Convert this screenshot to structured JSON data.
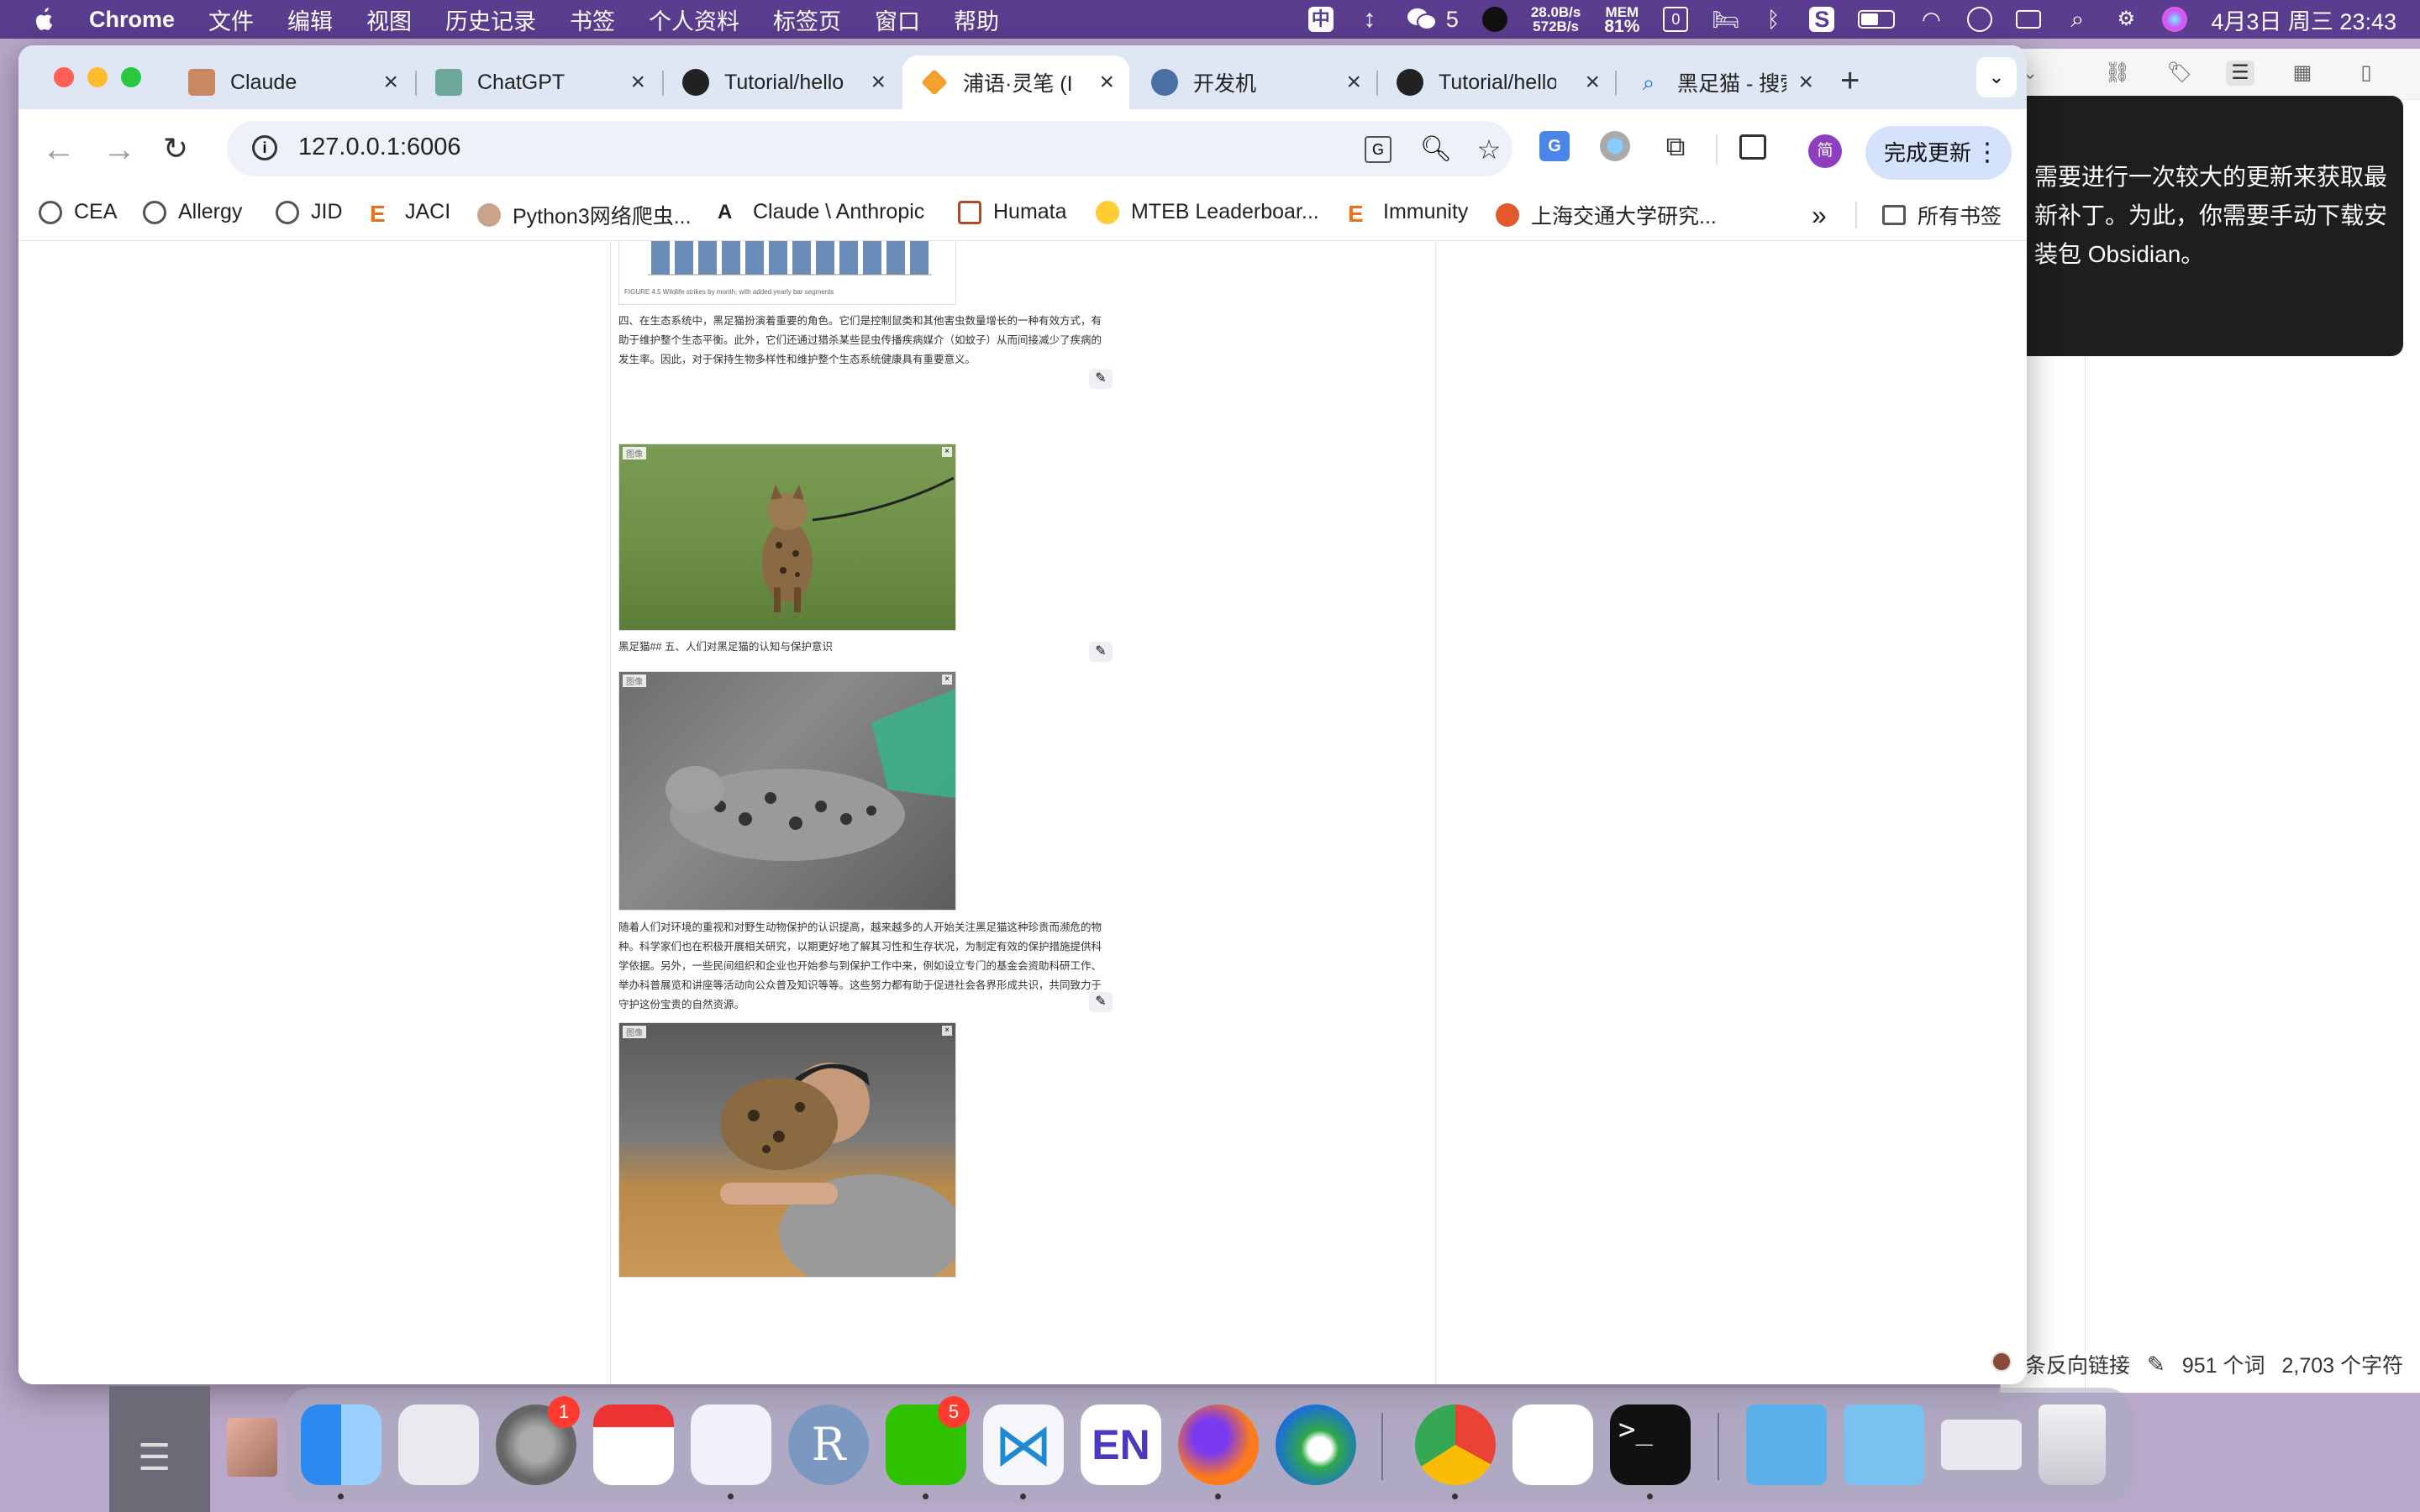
{
  "menubar": {
    "app": "Chrome",
    "items": [
      "文件",
      "编辑",
      "视图",
      "历史记录",
      "书签",
      "个人资料",
      "标签页",
      "窗口",
      "帮助"
    ],
    "wechat_count": "5",
    "net_up": "28.0B/s",
    "net_down": "572B/s",
    "mem_label": "MEM",
    "mem_value": "81%",
    "cal_day": "0",
    "datetime": "4月3日 周三  23:43"
  },
  "tabs": [
    {
      "title": "Claude",
      "color": "#c98860"
    },
    {
      "title": "ChatGPT",
      "color": "#6ea89a"
    },
    {
      "title": "Tutorial/hello",
      "color": "#222222"
    },
    {
      "title": "浦语·灵笔 (In",
      "color": "#f2a22c"
    },
    {
      "title": "开发机",
      "color": "#4a6fa5"
    },
    {
      "title": "Tutorial/hello",
      "color": "#222222"
    },
    {
      "title": "黑足猫 - 搜索",
      "color": "#1a73e8"
    }
  ],
  "address": {
    "url": "127.0.0.1:6006"
  },
  "update_button": "完成更新",
  "profile_initial": "简",
  "bookmarks": [
    "CEA",
    "Allergy",
    "JID",
    "JACI",
    "Python3网络爬虫...",
    "Claude \\ Anthropic",
    "Humata",
    "MTEB Leaderboar...",
    "Immunity",
    "上海交通大学研究...",
    "所有书签"
  ],
  "article": {
    "figure_caption": "FIGURE 4.5   Wildlife strikes by month, with added yearly bar segments",
    "para1": "四、在生态系统中，黑足猫扮演着重要的角色。它们是控制鼠类和其他害虫数量增长的一种有效方式，有助于维护整个生态平衡。此外，它们还通过猎杀某些昆虫传播疾病媒介（如蚊子）从而间接减少了疾病的发生率。因此，对于保持生物多样性和维护整个生态系统健康具有重要意义。",
    "heading": "黑足猫## 五、人们对黑足猫的认知与保护意识",
    "para2": "随着人们对环境的重视和对野生动物保护的认识提高，越来越多的人开始关注黑足猫这种珍贵而濒危的物种。科学家们也在积极开展相关研究，以期更好地了解其习性和生存状况，为制定有效的保护措施提供科学依据。另外，一些民间组织和企业也开始参与到保护工作中来，例如设立专门的基金会资助科研工作、举办科普展览和讲座等活动向公众普及知识等等。这些努力都有助于促进社会各界形成共识，共同致力于守护这份宝贵的自然资源。",
    "image_tag": "图像"
  },
  "obsidian": {
    "toast": "需要进行一次较大的更新来获取最新补丁。为此，你需要手动下载安装包 Obsidian。",
    "backlinks": "条反向链接",
    "words": "951 个词",
    "chars": "2,703 个字符"
  },
  "dock": {
    "settings_badge": "1",
    "wechat_badge": "5"
  }
}
